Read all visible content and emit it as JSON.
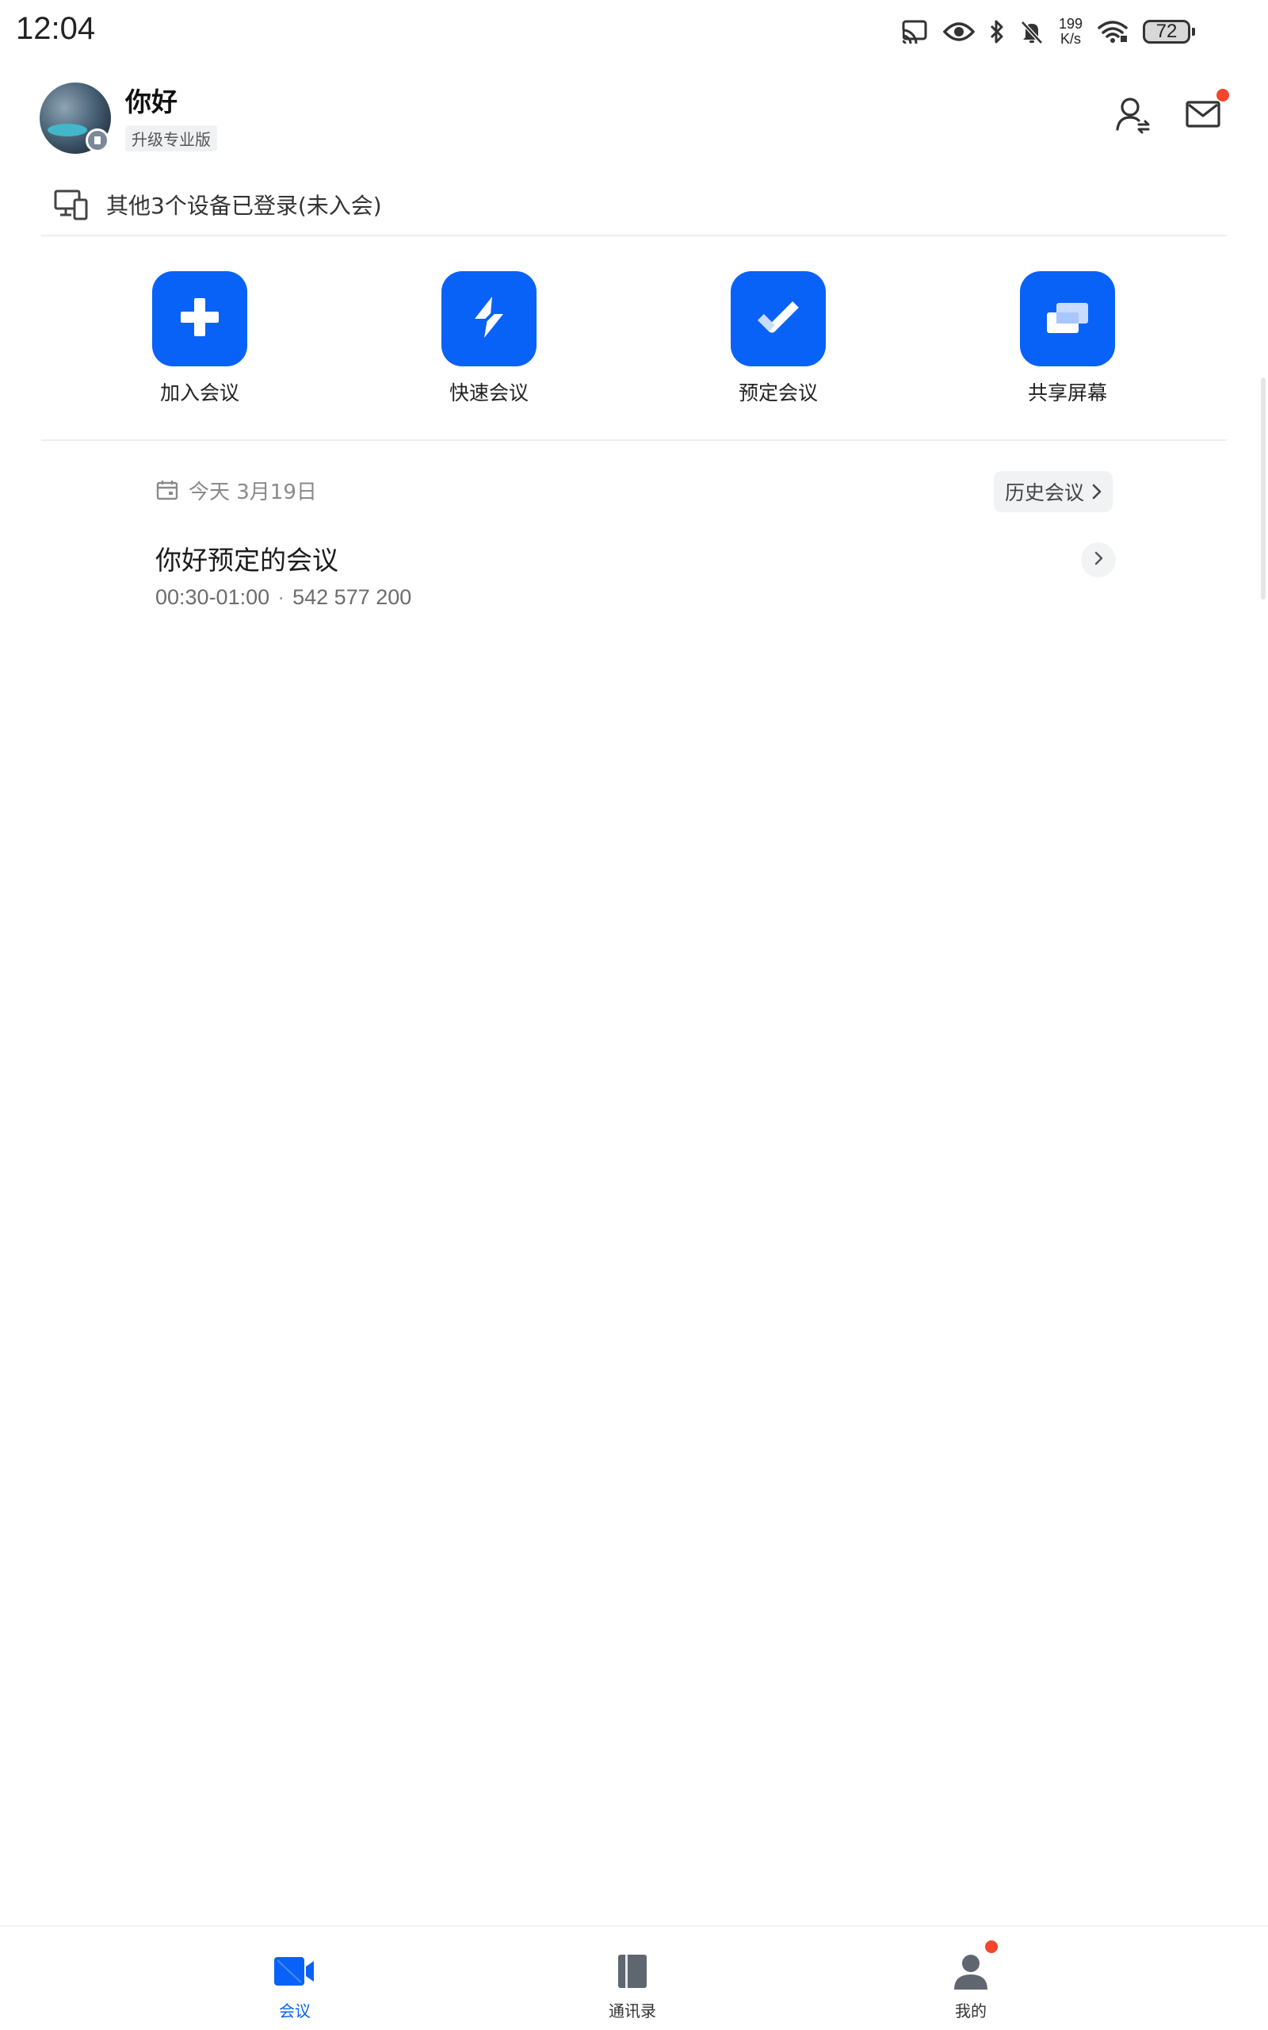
{
  "status_bar": {
    "time": "12:04",
    "net_speed_value": "199",
    "net_speed_unit": "K/s",
    "battery": "72",
    "icons": [
      "cast-icon",
      "eye-icon",
      "bluetooth-icon",
      "mute-bell-icon",
      "wifi-icon",
      "battery-icon"
    ]
  },
  "header": {
    "user_name": "你好",
    "upgrade_label": "升级专业版",
    "icons": [
      "user-switch-icon",
      "mail-icon"
    ]
  },
  "devices": {
    "text": "其他3个设备已登录(未入会)"
  },
  "quick_actions": [
    {
      "label": "加入会议",
      "icon": "plus-icon"
    },
    {
      "label": "快速会议",
      "icon": "lightning-icon"
    },
    {
      "label": "预定会议",
      "icon": "check-icon"
    },
    {
      "label": "共享屏幕",
      "icon": "share-screen-icon"
    }
  ],
  "meetings": {
    "date_label": "今天 3月19日",
    "history_label": "历史会议",
    "items": [
      {
        "title": "你好预定的会议",
        "time": "00:30-01:00",
        "meeting_id": "542 577 200"
      }
    ]
  },
  "tabs": [
    {
      "label": "会议",
      "icon": "video-camera-icon",
      "active": true
    },
    {
      "label": "通讯录",
      "icon": "address-book-icon",
      "active": false
    },
    {
      "label": "我的",
      "icon": "person-icon",
      "active": false
    }
  ],
  "colors": {
    "accent": "#0862f7",
    "notification_dot": "#f5462b"
  }
}
